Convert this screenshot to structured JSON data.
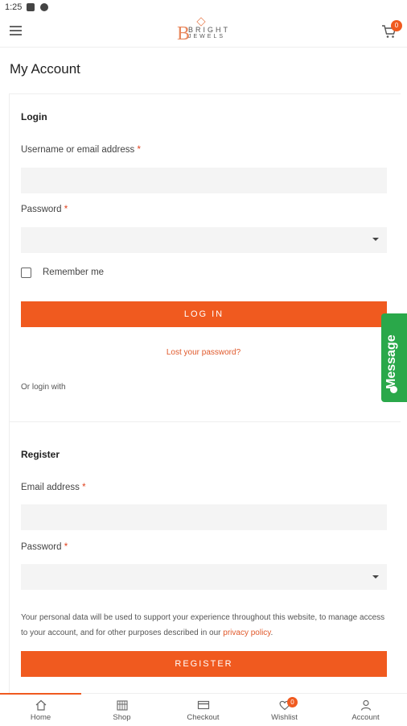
{
  "status_bar": {
    "time": "1:25"
  },
  "header": {
    "logo_letter": "B",
    "logo_word1": "BRIGHT",
    "logo_word2": "JEWELS",
    "cart_count": "0"
  },
  "page_title": "My Account",
  "login": {
    "title": "Login",
    "username_label": "Username or email address",
    "password_label": "Password",
    "required_mark": "*",
    "remember_label": "Remember me",
    "button_label": "LOG IN",
    "lost_password": "Lost your password?",
    "or_login_with": "Or login with"
  },
  "register": {
    "title": "Register",
    "email_label": "Email address",
    "password_label": "Password",
    "privacy_text": "Your personal data will be used to support your experience throughout this website, to manage access to your account, and for other purposes described in our",
    "privacy_link": "privacy policy",
    "privacy_end": ".",
    "button_label": "REGISTER"
  },
  "message_tab": {
    "label": "Message"
  },
  "bottom_nav": {
    "items": [
      {
        "label": "Home",
        "icon": "home-icon"
      },
      {
        "label": "Shop",
        "icon": "shop-icon"
      },
      {
        "label": "Checkout",
        "icon": "card-icon"
      },
      {
        "label": "Wishlist",
        "icon": "heart-icon"
      },
      {
        "label": "Account",
        "icon": "user-icon"
      }
    ],
    "wishlist_count": "0"
  },
  "colors": {
    "accent": "#f05a1f",
    "message_green": "#2aa84a"
  }
}
